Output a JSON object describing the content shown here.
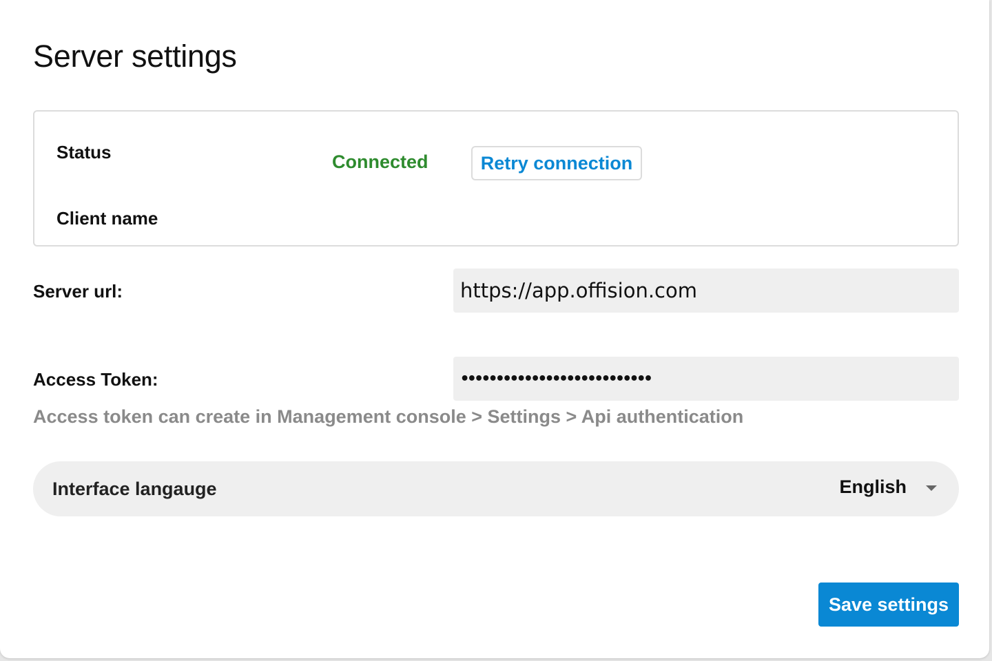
{
  "colors": {
    "accent": "#0a88d4",
    "status_connected": "#2e8b2e",
    "hint": "#8a8a8a"
  },
  "page": {
    "title": "Server settings"
  },
  "status_panel": {
    "status_label": "Status",
    "status_value": "Connected",
    "retry_label": "Retry connection",
    "client_name_label": "Client name"
  },
  "server_url": {
    "label": "Server url:",
    "value": "https://app.offision.com"
  },
  "access_token": {
    "label": "Access Token:",
    "masked_value": "•••••••••••••••••••••••••••",
    "hint": "Access token can create in Management console > Settings > Api authentication"
  },
  "interface_language": {
    "label": "Interface langauge",
    "selected": "English",
    "icon": "chevron-down-icon"
  },
  "actions": {
    "save_label": "Save settings"
  }
}
